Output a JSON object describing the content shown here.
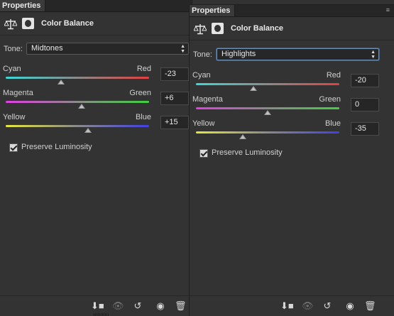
{
  "left_panel": {
    "tab_title": "Properties",
    "adjustment_title": "Color Balance",
    "tone_label": "Tone:",
    "tone_value": "Midtones",
    "sliders": [
      {
        "left": "Cyan",
        "right": "Red",
        "value": "-23",
        "level": -23
      },
      {
        "left": "Magenta",
        "right": "Green",
        "value": "+6",
        "level": 6
      },
      {
        "left": "Yellow",
        "right": "Blue",
        "value": "+15",
        "level": 15
      }
    ],
    "preserve_luminosity": "Preserve Luminosity"
  },
  "right_panel": {
    "tab_title": "Properties",
    "adjustment_title": "Color Balance",
    "tone_label": "Tone:",
    "tone_value": "Highlights",
    "sliders": [
      {
        "left": "Cyan",
        "right": "Red",
        "value": "-20",
        "level": -20
      },
      {
        "left": "Magenta",
        "right": "Green",
        "value": "0",
        "level": 0
      },
      {
        "left": "Yellow",
        "right": "Blue",
        "value": "-35",
        "level": -35
      }
    ],
    "preserve_luminosity": "Preserve Luminosity"
  },
  "colors": {
    "cyan_red": "linear-gradient(90deg,#3fd6d6,#8a8a8a 50%,#e04040)",
    "magenta_green": "linear-gradient(90deg,#e040e0,#8a8a8a 50%,#40d040)",
    "yellow_blue": "linear-gradient(90deg,#e6e640,#8a8a8a 50%,#4040e0)"
  },
  "icons": [
    "clip-to-layer-icon",
    "view-previous-state-icon",
    "reset-icon",
    "visibility-eye-icon",
    "delete-icon"
  ]
}
